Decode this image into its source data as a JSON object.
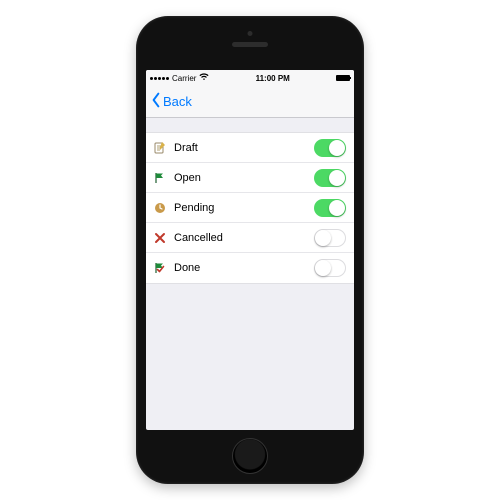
{
  "status_bar": {
    "carrier": "Carrier",
    "time": "11:00 PM"
  },
  "nav": {
    "back_label": "Back"
  },
  "rows": [
    {
      "icon": "draft-icon",
      "label": "Draft",
      "on": true
    },
    {
      "icon": "open-icon",
      "label": "Open",
      "on": true
    },
    {
      "icon": "pending-icon",
      "label": "Pending",
      "on": true
    },
    {
      "icon": "cancelled-icon",
      "label": "Cancelled",
      "on": false
    },
    {
      "icon": "done-icon",
      "label": "Done",
      "on": false
    }
  ],
  "colors": {
    "tint": "#007aff",
    "toggle_on": "#4cd964"
  }
}
